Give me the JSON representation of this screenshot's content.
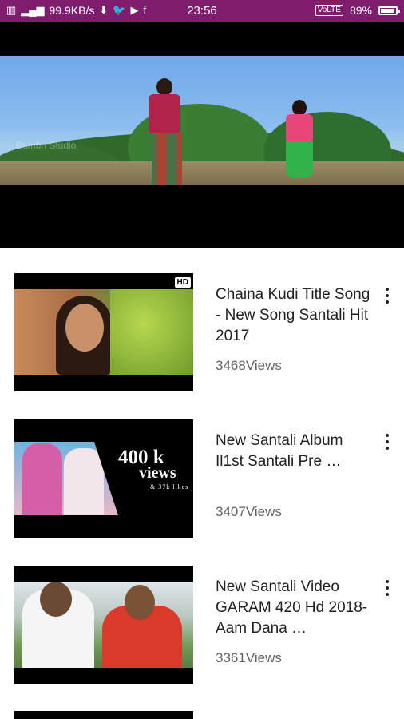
{
  "status_bar": {
    "network_speed": "99.9KB/s",
    "time": "23:56",
    "volte": "VoLTE",
    "battery_percent": "89%",
    "battery_level": 0.89,
    "icons": [
      "sim-icon",
      "signal-icon",
      "download-icon",
      "twitter-icon",
      "youtube-icon",
      "facebook-icon"
    ]
  },
  "player": {
    "watermark": "Bambri Studio"
  },
  "videos": [
    {
      "title": "Chaina Kudi Title Song - New Song Santali Hit 2017",
      "views": "3468Views",
      "badge": "HD"
    },
    {
      "title": "New Santali Album Il1st Santali Pre …",
      "views": "3407Views",
      "thumb_text_big": "400 k",
      "thumb_text_views": "views",
      "thumb_text_small": "& 37k  likes"
    },
    {
      "title": "New Santali Video GARAM 420 Hd 2018-Aam Dana …",
      "views": "3361Views"
    }
  ],
  "colors": {
    "status_bar": "#7e1d6e",
    "text_primary": "#212121",
    "text_secondary": "#616161"
  }
}
